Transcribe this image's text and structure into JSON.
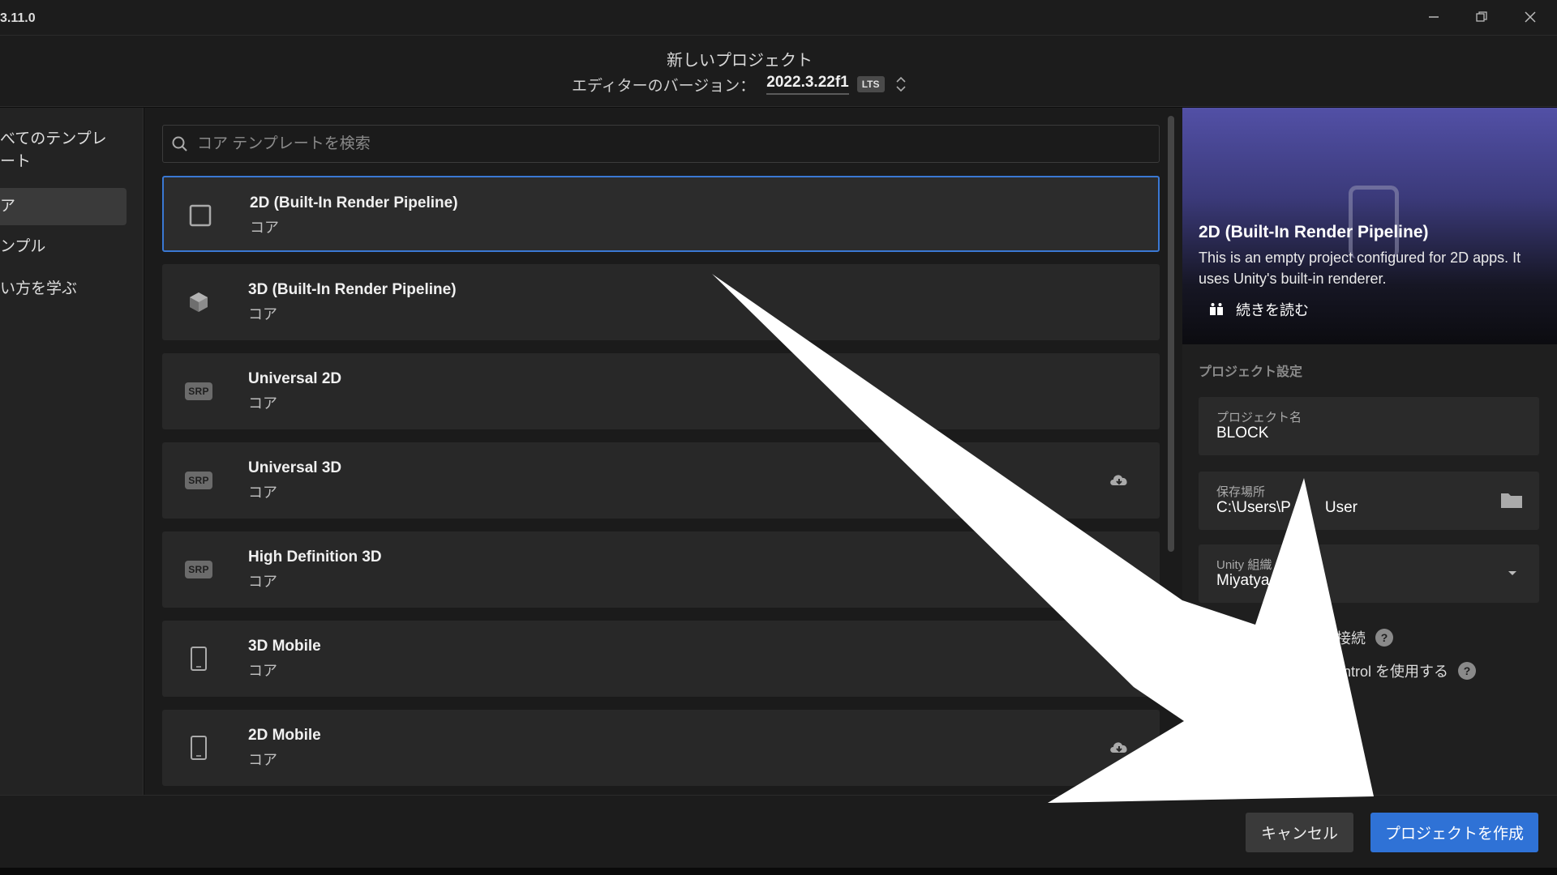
{
  "app": {
    "version": "3.11.0"
  },
  "window": {
    "minimize_icon": "minimize-icon",
    "maximize_icon": "restore-icon",
    "close_icon": "close-icon"
  },
  "header": {
    "title": "新しいプロジェクト",
    "version_label": "エディターのバージョン：",
    "version_value": "2022.3.22f1",
    "lts_badge": "LTS"
  },
  "sidebar": {
    "items": [
      {
        "label": "べてのテンプレ\nート"
      },
      {
        "label": "ア"
      },
      {
        "label": "ンプル"
      },
      {
        "label": "い方を学ぶ"
      }
    ]
  },
  "search": {
    "placeholder": "コア テンプレートを検索"
  },
  "templates": [
    {
      "name": "2D (Built-In Render Pipeline)",
      "category": "コア",
      "icon": "square-outline-icon",
      "selected": true
    },
    {
      "name": "3D (Built-In Render Pipeline)",
      "category": "コア",
      "icon": "cube-icon"
    },
    {
      "name": "Universal 2D",
      "category": "コア",
      "icon": "srp-icon",
      "icon_text": "SRP"
    },
    {
      "name": "Universal 3D",
      "category": "コア",
      "icon": "srp-icon",
      "icon_text": "SRP",
      "download": true
    },
    {
      "name": "High Definition 3D",
      "category": "コア",
      "icon": "srp-icon",
      "icon_text": "SRP"
    },
    {
      "name": "3D Mobile",
      "category": "コア",
      "icon": "phone-icon",
      "download": true
    },
    {
      "name": "2D Mobile",
      "category": "コア",
      "icon": "phone-icon",
      "download": true
    }
  ],
  "preview": {
    "title": "2D (Built-In Render Pipeline)",
    "description": "This is an empty project configured for 2D apps. It uses Unity's built-in renderer.",
    "read_more": "続きを読む"
  },
  "settings": {
    "section_label": "プロジェクト設定",
    "project_name_label": "プロジェクト名",
    "project_name_value": "BLOCK",
    "location_label": "保存場所",
    "location_value": "C:\\Users\\P",
    "location_value_tail": "User",
    "org_label": "Unity 組織",
    "org_value": "Miyatya",
    "option1": "接続",
    "option2": "ntrol を使用する",
    "help": "?"
  },
  "footer": {
    "cancel": "キャンセル",
    "create": "プロジェクトを作成"
  },
  "colors": {
    "accent": "#2f72d6",
    "selected_border": "#3a78d3",
    "background": "#1b1b1b"
  }
}
